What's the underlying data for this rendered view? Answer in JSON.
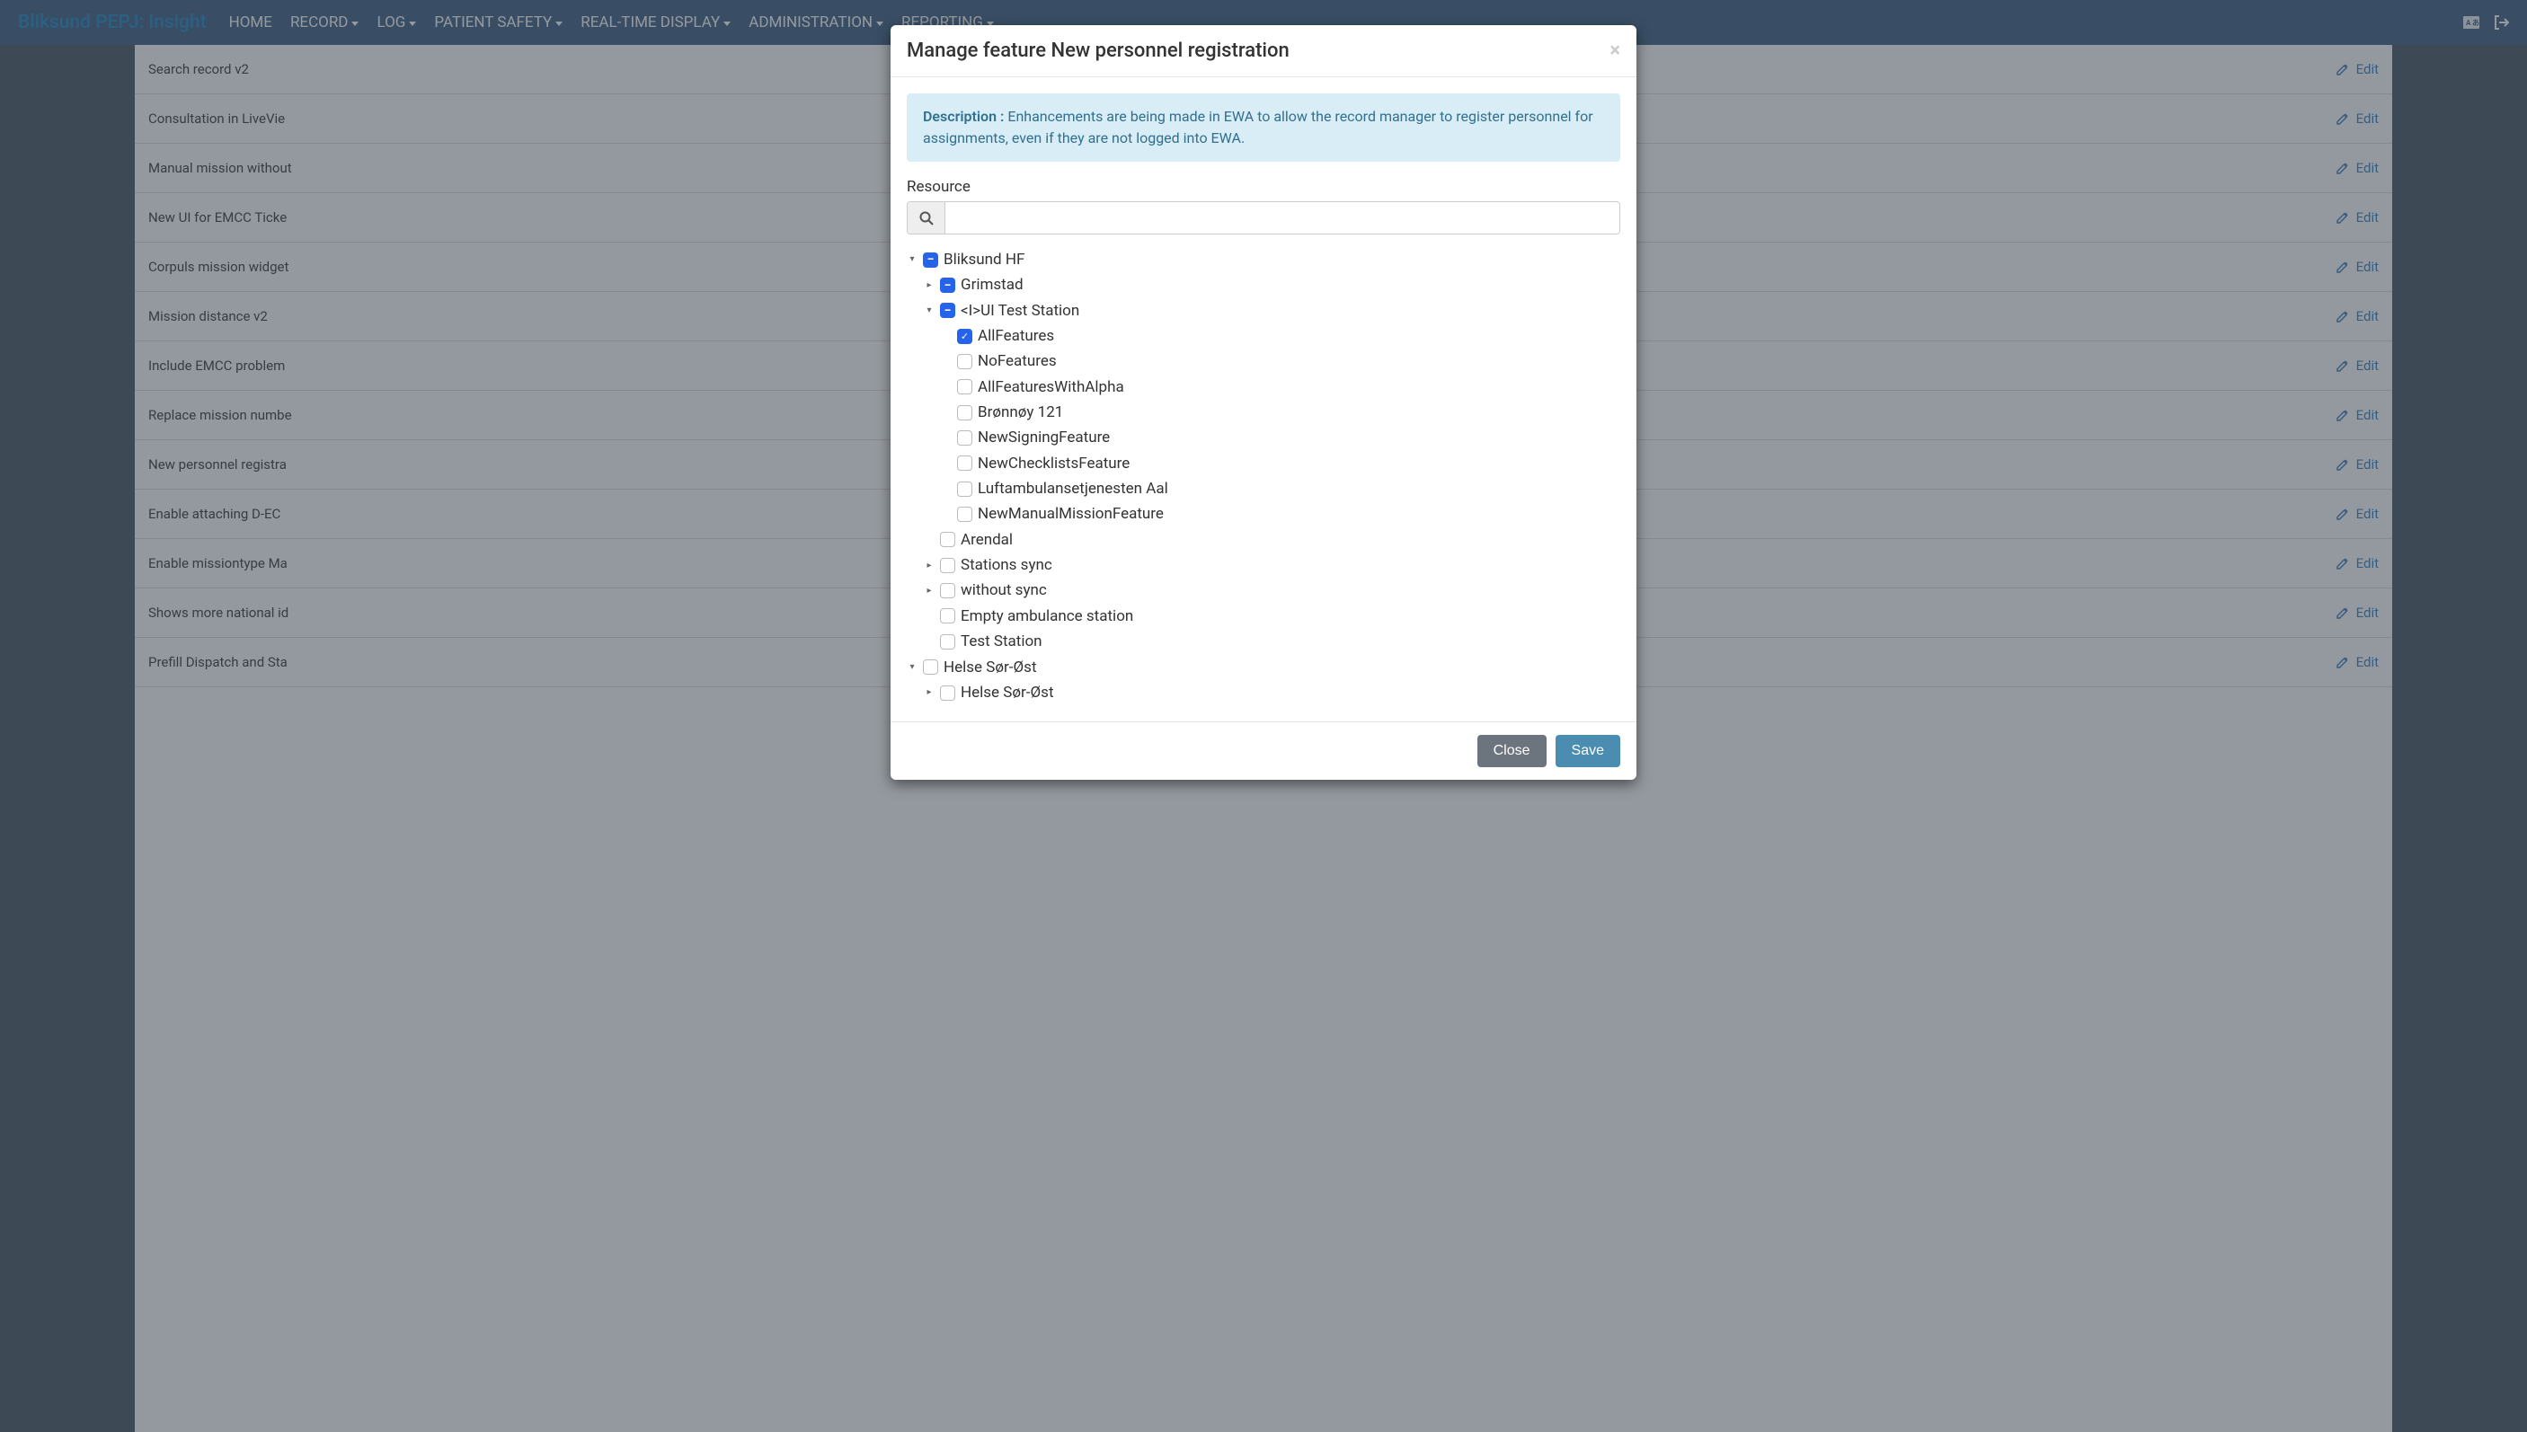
{
  "brand": "Bliksund PEPJ: Insight",
  "nav": {
    "home": "HOME",
    "record": "RECORD",
    "log": "LOG",
    "patientSafety": "PATIENT SAFETY",
    "realtime": "REAL-TIME DISPLAY",
    "admin": "ADMINISTRATION",
    "reporting": "REPORTING"
  },
  "bgRows": [
    "Search record v2",
    "Consultation in LiveVie",
    "Manual mission without",
    "New UI for EMCC Ticke",
    "Corpuls mission widget",
    "Mission distance v2",
    "Include EMCC problem",
    "Replace mission numbe",
    "New personnel registra",
    "Enable attaching D-EC",
    "Enable missiontype Ma",
    "Shows more national id",
    "Prefill Dispatch and Sta"
  ],
  "editLabel": "Edit",
  "modal": {
    "title": "Manage feature New personnel registration",
    "descLabel": "Description :",
    "descText": "Enhancements are being made in EWA to allow the record manager to register personnel for assignments, even if they are not logged into EWA.",
    "resourceLabel": "Resource",
    "searchPlaceholder": "",
    "close": "Close",
    "save": "Save"
  },
  "tree": {
    "root": {
      "label": "Bliksund HF",
      "state": "partial",
      "expanded": true
    },
    "grimstad": {
      "label": "Grimstad",
      "state": "partial",
      "expanded": false
    },
    "uitest": {
      "label": "<I>UI Test Station",
      "state": "partial",
      "expanded": true
    },
    "leaves": [
      {
        "label": "AllFeatures",
        "state": "checked"
      },
      {
        "label": "NoFeatures",
        "state": "empty"
      },
      {
        "label": "AllFeaturesWithAlpha",
        "state": "empty"
      },
      {
        "label": "Brønnøy 121",
        "state": "empty"
      },
      {
        "label": "NewSigningFeature",
        "state": "empty"
      },
      {
        "label": "NewChecklistsFeature",
        "state": "empty"
      },
      {
        "label": "Luftambulansetjenesten Aal",
        "state": "empty"
      },
      {
        "label": "NewManualMissionFeature",
        "state": "empty"
      }
    ],
    "arendal": {
      "label": "Arendal",
      "state": "empty"
    },
    "stationsSync": {
      "label": "Stations sync",
      "state": "empty",
      "hasChildren": true
    },
    "withoutSync": {
      "label": "without sync",
      "state": "empty",
      "hasChildren": true
    },
    "emptyAmb": {
      "label": "Empty ambulance station",
      "state": "empty"
    },
    "testStation": {
      "label": "Test Station",
      "state": "empty"
    },
    "helse1": {
      "label": "Helse Sør-Øst",
      "state": "empty",
      "expanded": true
    },
    "helse2": {
      "label": "Helse Sør-Øst",
      "state": "empty",
      "hasChildren": true
    }
  }
}
